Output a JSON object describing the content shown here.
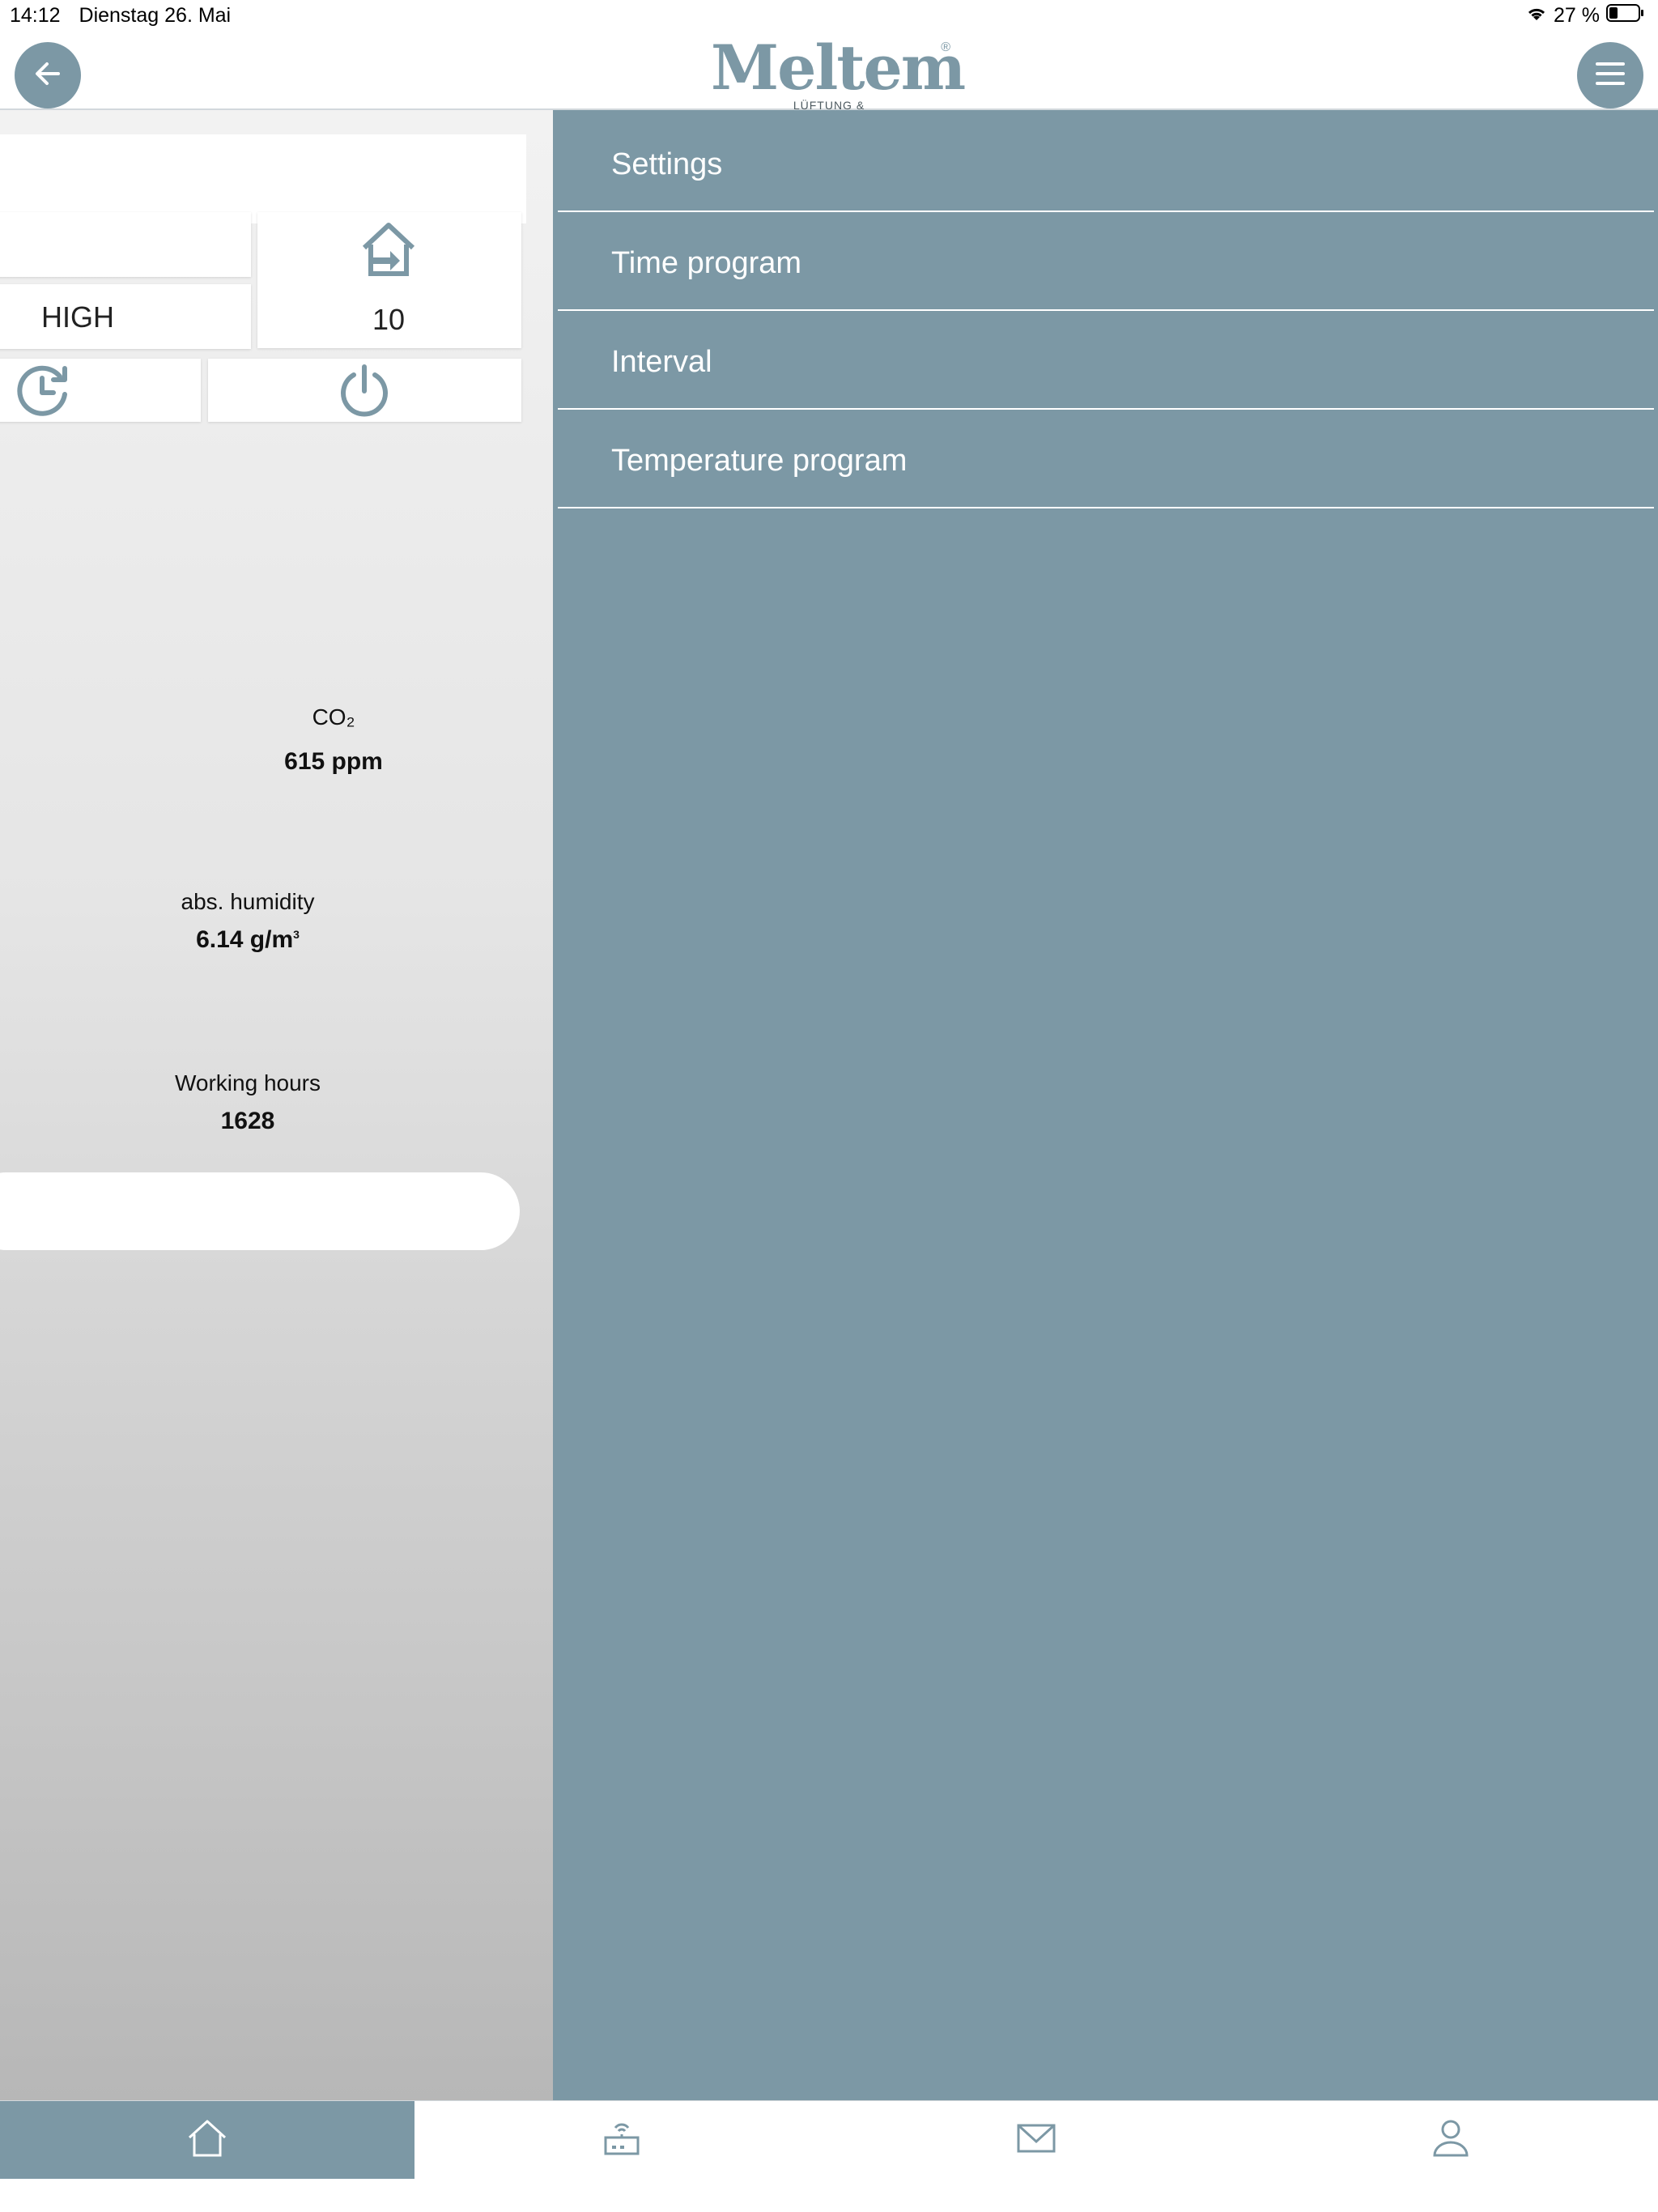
{
  "status_bar": {
    "time": "14:12",
    "date": "Dienstag 26. Mai",
    "battery": "27 %"
  },
  "header": {
    "logo_text": "Meltem",
    "logo_subtitle": "LÜFTUNG & WÄRMERÜCKGEWINNUNG",
    "logo_registered": "®"
  },
  "tiles": {
    "mode_value": "HIGH",
    "level_value": "10"
  },
  "sensors": {
    "co2_label": "CO₂",
    "co2_value": "615 ppm",
    "humidity_label": "abs. humidity",
    "humidity_value": "6.14 g/m",
    "humidity_sup": "3",
    "hours_label": "Working hours",
    "hours_value": "1628"
  },
  "menu": {
    "items": [
      "Settings",
      "Time program",
      "Interval",
      "Temperature program"
    ]
  },
  "tab_bar": {
    "tabs": [
      "home-icon",
      "device-icon",
      "mail-icon",
      "user-icon"
    ],
    "active": "home-icon"
  },
  "colors": {
    "accent": "#7c98a5",
    "menu_background": "#7c98a5"
  }
}
